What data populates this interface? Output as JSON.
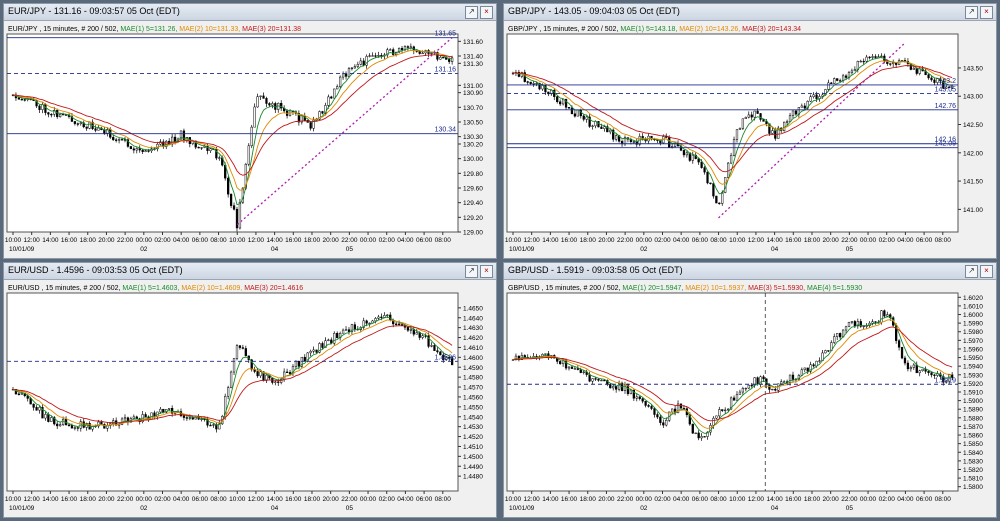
{
  "panels": [
    {
      "title": "EUR/JPY - 131.16 - 09:03:57  05 Oct (EDT)",
      "legend": {
        "info": "EUR/JPY , 15 minutes, # 200 / 502,",
        "mae1": "MAE(1) 5=131.26,",
        "mae2": "MAE(2) 10=131.33,",
        "mae3": "MAE(3) 20=131.38"
      },
      "chart_data": {
        "type": "candlestick",
        "ylim": [
          129.0,
          131.7
        ],
        "yticks": [
          "131.60",
          "131.40",
          "131.30",
          "131.00",
          "130.90",
          "130.70",
          "130.50",
          "130.30",
          "130.20",
          "130.00",
          "129.80",
          "129.60",
          "129.40",
          "129.20",
          "129.00"
        ],
        "xticks": [
          "10:00",
          "12:00",
          "14:00",
          "16:00",
          "18:00",
          "20:00",
          "22:00",
          "00:00",
          "02:00",
          "04:00",
          "06:00",
          "08:00",
          "10:00",
          "12:00",
          "14:00",
          "16:00",
          "18:00",
          "20:00",
          "22:00",
          "00:00",
          "02:00",
          "04:00",
          "06:00",
          "08:00"
        ],
        "dates": [
          {
            "label": "10/01/09",
            "at": 0
          },
          {
            "label": "02",
            "at": 7
          },
          {
            "label": "04",
            "at": 14
          },
          {
            "label": "05",
            "at": 18
          }
        ],
        "waypoints": [
          [
            0,
            130.9
          ],
          [
            2,
            130.65
          ],
          [
            5,
            130.35
          ],
          [
            7,
            130.1
          ],
          [
            9,
            130.32
          ],
          [
            11,
            130.05
          ],
          [
            12,
            129.1
          ],
          [
            13,
            130.85
          ],
          [
            15,
            130.6
          ],
          [
            16,
            130.45
          ],
          [
            18,
            131.25
          ],
          [
            20,
            131.45
          ],
          [
            22,
            131.5
          ],
          [
            23,
            131.38
          ]
        ],
        "seed": 11,
        "hlines": [
          {
            "value": 131.65,
            "style": "solid",
            "color": "#1b2a8c",
            "label": "131.65"
          },
          {
            "value": 131.16,
            "style": "dashed",
            "color": "#1b2a8c",
            "label": "131.16"
          },
          {
            "value": 130.34,
            "style": "solid",
            "color": "#1b2a8c",
            "label": "130.34"
          }
        ],
        "trendline": {
          "from": [
            12,
            129.1
          ],
          "to": [
            23.5,
            131.65
          ]
        },
        "vline": null
      }
    },
    {
      "title": "GBP/JPY - 143.05 - 09:04:03  05 Oct (EDT)",
      "legend": {
        "info": "GBP/JPY , 15 minutes, # 200 / 502,",
        "mae1": "MAE(1) 5=143.18,",
        "mae2": "MAE(2) 10=143.26,",
        "mae3": "MAE(3) 20=143.34"
      },
      "chart_data": {
        "type": "candlestick",
        "ylim": [
          140.6,
          144.1
        ],
        "yticks": [
          "143.50",
          "143.00",
          "142.50",
          "142.00",
          "141.50",
          "141.00"
        ],
        "xticks": [
          "10:00",
          "12:00",
          "14:00",
          "16:00",
          "18:00",
          "20:00",
          "22:00",
          "00:00",
          "02:00",
          "04:00",
          "06:00",
          "08:00",
          "10:00",
          "12:00",
          "14:00",
          "16:00",
          "18:00",
          "20:00",
          "22:00",
          "00:00",
          "02:00",
          "04:00",
          "06:00",
          "08:00"
        ],
        "dates": [
          {
            "label": "10/01/09",
            "at": 0
          },
          {
            "label": "02",
            "at": 7
          },
          {
            "label": "04",
            "at": 14
          },
          {
            "label": "05",
            "at": 18
          }
        ],
        "waypoints": [
          [
            0,
            143.45
          ],
          [
            2,
            143.05
          ],
          [
            4,
            142.55
          ],
          [
            6,
            142.2
          ],
          [
            8,
            142.25
          ],
          [
            10,
            141.8
          ],
          [
            11,
            141.1
          ],
          [
            12,
            142.45
          ],
          [
            13,
            142.7
          ],
          [
            14,
            142.3
          ],
          [
            15,
            142.7
          ],
          [
            17,
            143.2
          ],
          [
            19,
            143.7
          ],
          [
            21,
            143.6
          ],
          [
            23,
            143.2
          ]
        ],
        "seed": 23,
        "hlines": [
          {
            "value": 143.2,
            "style": "solid",
            "color": "#1b2a8c",
            "label": "143.2"
          },
          {
            "value": 143.05,
            "style": "dashed",
            "color": "#1b2a8c",
            "label": "143.05"
          },
          {
            "value": 142.76,
            "style": "solid",
            "color": "#1b2a8c",
            "label": "142.76"
          },
          {
            "value": 142.16,
            "style": "solid",
            "color": "#1b2a8c",
            "label": "142.16"
          },
          {
            "value": 142.09,
            "style": "solid",
            "color": "#1b2a8c",
            "label": "142.09"
          }
        ],
        "trendline": {
          "from": [
            11,
            140.85
          ],
          "to": [
            21,
            143.95
          ]
        },
        "vline": null
      }
    },
    {
      "title": "EUR/USD - 1.4596 - 09:03:53  05 Oct (EDT)",
      "legend": {
        "info": "EUR/USD , 15 minutes, # 200 / 502,",
        "mae1": "MAE(1) 5=1.4603,",
        "mae2": "MAE(2) 10=1.4609,",
        "mae3": "MAE(3) 20=1.4616"
      },
      "chart_data": {
        "type": "candlestick",
        "ylim": [
          1.4465,
          1.4665
        ],
        "yticks": [
          "1.4650",
          "1.4640",
          "1.4630",
          "1.4620",
          "1.4610",
          "1.4600",
          "1.4590",
          "1.4580",
          "1.4570",
          "1.4560",
          "1.4550",
          "1.4540",
          "1.4530",
          "1.4520",
          "1.4510",
          "1.4500",
          "1.4490",
          "1.4480"
        ],
        "xticks": [
          "10:00",
          "12:00",
          "14:00",
          "16:00",
          "18:00",
          "20:00",
          "22:00",
          "00:00",
          "02:00",
          "04:00",
          "06:00",
          "08:00",
          "10:00",
          "12:00",
          "14:00",
          "16:00",
          "18:00",
          "20:00",
          "22:00",
          "00:00",
          "02:00",
          "04:00",
          "06:00",
          "08:00"
        ],
        "dates": [
          {
            "label": "10/01/09",
            "at": 0
          },
          {
            "label": "02",
            "at": 7
          },
          {
            "label": "04",
            "at": 14
          },
          {
            "label": "05",
            "at": 18
          }
        ],
        "waypoints": [
          [
            0,
            1.457
          ],
          [
            2,
            1.4535
          ],
          [
            4,
            1.453
          ],
          [
            6,
            1.4535
          ],
          [
            8,
            1.4545
          ],
          [
            10,
            1.454
          ],
          [
            11,
            1.4525
          ],
          [
            12,
            1.4615
          ],
          [
            13,
            1.4585
          ],
          [
            14,
            1.4575
          ],
          [
            15,
            1.459
          ],
          [
            16,
            1.4605
          ],
          [
            18,
            1.463
          ],
          [
            20,
            1.464
          ],
          [
            22,
            1.462
          ],
          [
            23,
            1.4596
          ]
        ],
        "seed": 37,
        "hlines": [
          {
            "value": 1.4596,
            "style": "dashed",
            "color": "#1b2a8c",
            "label": "1.4596"
          }
        ],
        "trendline": null,
        "vline": null
      }
    },
    {
      "title": "GBP/USD - 1.5919 - 09:03:58  05 Oct (EDT)",
      "legend": {
        "info": "GBP/USD , 15 minutes, # 200 / 502,",
        "mae1": "MAE(1) 20=1.5947,",
        "mae2": "MAE(2) 10=1.5937,",
        "mae3": "MAE(3) 5=1.5930,",
        "mae4": "MAE(4) 5=1.5930"
      },
      "chart_data": {
        "type": "candlestick",
        "ylim": [
          1.5795,
          1.6025
        ],
        "yticks": [
          "1.6020",
          "1.6010",
          "1.6000",
          "1.5990",
          "1.5980",
          "1.5970",
          "1.5960",
          "1.5950",
          "1.5940",
          "1.5930",
          "1.5920",
          "1.5910",
          "1.5900",
          "1.5890",
          "1.5880",
          "1.5870",
          "1.5860",
          "1.5850",
          "1.5840",
          "1.5830",
          "1.5820",
          "1.5810",
          "1.5800"
        ],
        "xticks": [
          "10:00",
          "12:00",
          "14:00",
          "16:00",
          "18:00",
          "20:00",
          "22:00",
          "00:00",
          "02:00",
          "04:00",
          "06:00",
          "08:00",
          "10:00",
          "12:00",
          "14:00",
          "16:00",
          "18:00",
          "20:00",
          "22:00",
          "00:00",
          "02:00",
          "04:00",
          "06:00",
          "08:00"
        ],
        "dates": [
          {
            "label": "10/01/09",
            "at": 0
          },
          {
            "label": "02",
            "at": 7
          },
          {
            "label": "04",
            "at": 14
          },
          {
            "label": "05",
            "at": 18
          }
        ],
        "waypoints": [
          [
            0,
            1.595
          ],
          [
            2,
            1.5955
          ],
          [
            4,
            1.5925
          ],
          [
            6,
            1.5915
          ],
          [
            8,
            1.5875
          ],
          [
            9,
            1.5895
          ],
          [
            10,
            1.585
          ],
          [
            11,
            1.5885
          ],
          [
            13,
            1.5925
          ],
          [
            14,
            1.5915
          ],
          [
            16,
            1.594
          ],
          [
            18,
            1.599
          ],
          [
            19,
            1.5985
          ],
          [
            20,
            1.6005
          ],
          [
            21,
            1.594
          ],
          [
            23,
            1.5925
          ]
        ],
        "seed": 53,
        "hlines": [
          {
            "value": 1.5919,
            "style": "dashed",
            "color": "#1b2a8c",
            "label": "1.5919"
          }
        ],
        "trendline": null,
        "vline": {
          "x": 13.5
        }
      }
    }
  ],
  "colors": {
    "chart_bg": "#ffffff",
    "candle": "#000000",
    "mae1": "#1a8a2a",
    "mae2": "#e08a00",
    "mae3": "#c01818",
    "trend": "#b01ab0",
    "hline": "#1b2a8c"
  }
}
